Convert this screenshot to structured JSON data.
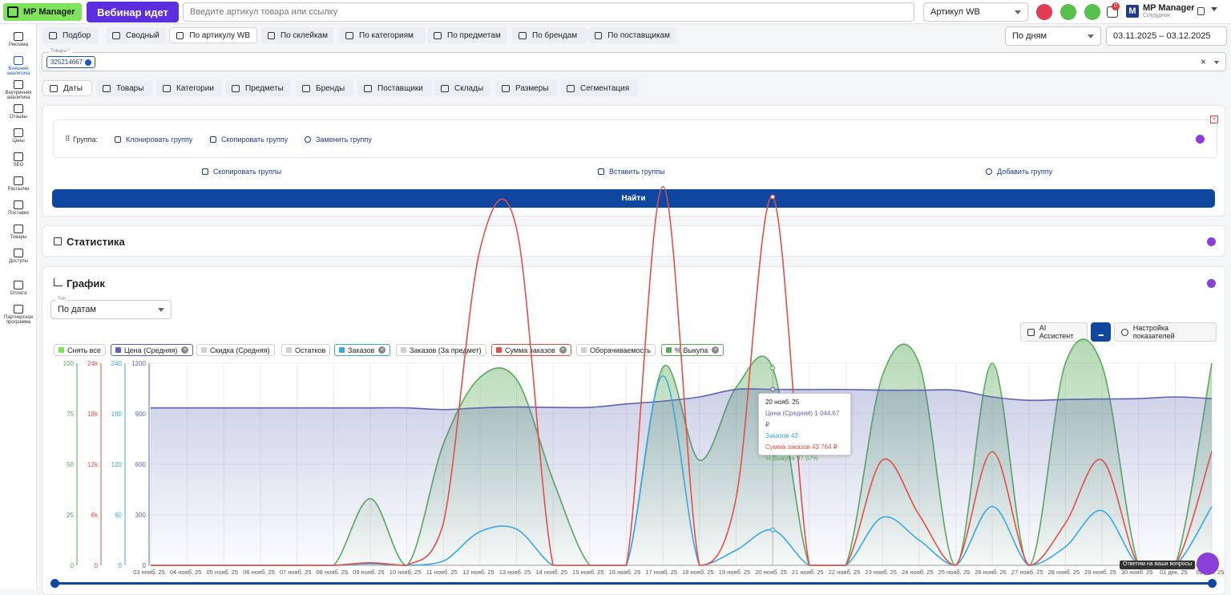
{
  "topbar": {
    "logo": "MP Manager",
    "webinar": "Вебинар идет",
    "search_placeholder": "Введите артикул товара или ссылку",
    "article_select": "Артикул WB",
    "notif_count": "0",
    "user_name": "MP Manager",
    "user_role": "Сотрудник"
  },
  "sidebar": [
    {
      "label": "Реклама",
      "icon": "ads-icon"
    },
    {
      "label": "Внешняя аналитика",
      "icon": "external-analytics-icon",
      "active": true
    },
    {
      "label": "Внутренняя аналитика",
      "icon": "internal-analytics-icon"
    },
    {
      "label": "Отзывы",
      "icon": "reviews-icon"
    },
    {
      "label": "Цены",
      "icon": "ruble-icon"
    },
    {
      "label": "SEO",
      "icon": "seo-icon"
    },
    {
      "label": "Рассылки",
      "icon": "mail-icon"
    },
    {
      "label": "Поставки",
      "icon": "truck-icon"
    },
    {
      "label": "Товары",
      "icon": "box-icon"
    },
    {
      "label": "Доступы",
      "icon": "lock-icon"
    },
    {
      "label": "Оплата",
      "icon": "wallet-icon"
    },
    {
      "label": "Партнерская программа",
      "icon": "partners-icon"
    }
  ],
  "tabs": [
    "Подбор",
    "Сводный",
    "По артикулу WB",
    "По склейкам",
    "По категориям",
    "По предметам",
    "По брендам",
    "По поставщикам"
  ],
  "period": {
    "value": "По дням",
    "date_range": "03.11.2025 – 03.12.2025"
  },
  "products": {
    "label": "Товары *",
    "chip": "325214667"
  },
  "subtabs": [
    "Даты",
    "Товары",
    "Категории",
    "Предметы",
    "Бренды",
    "Поставщики",
    "Склады",
    "Размеры",
    "Сегментация"
  ],
  "group": {
    "label": "Группа:",
    "clone": "Клонировать группу",
    "copy": "Скопировать группу",
    "replace": "Заменить группу",
    "copy_groups": "Скопировать группы",
    "paste_groups": "Вставить группы",
    "add_group": "Добавить группу",
    "find": "Найти"
  },
  "stats_title": "Статистика",
  "chart_section": {
    "title": "График",
    "type_label": "Тип",
    "type_value": "По датам",
    "ai": "AI Ассистент",
    "settings": "Настройка показателей",
    "chat_hint": "Ответим на ваши вопросы"
  },
  "legend": [
    {
      "label": "Снять все",
      "color": "#7ee35a",
      "x": false
    },
    {
      "label": "Цена (Средняя)",
      "color": "#5b64b0",
      "x": true
    },
    {
      "label": "Скидка (Средняя)",
      "color": "#cfcfcf",
      "x": false
    },
    {
      "label": "Остатков",
      "color": "#cfcfcf",
      "x": false
    },
    {
      "label": "Заказов",
      "color": "#3aa7e0",
      "x": true
    },
    {
      "label": "Заказов (За предмет)",
      "color": "#cfcfcf",
      "x": false
    },
    {
      "label": "Сумма заказов",
      "color": "#e0504a",
      "x": true
    },
    {
      "label": "Оборачиваемость",
      "color": "#cfcfcf",
      "x": false
    },
    {
      "label": "% Выкупа",
      "color": "#5aaa5a",
      "x": true
    }
  ],
  "tooltip": {
    "date": "20 нояб. 25",
    "price": "Цена (Средняя)  1 044.67 ₽",
    "orders": "Заказов  42",
    "sum": "Сумма заказов  43 764 ₽",
    "buyout": "% Выкупа  97.67%"
  },
  "chart_data": {
    "type": "area",
    "x": [
      "03 нояб. 25",
      "04 нояб. 25",
      "05 нояб. 25",
      "06 нояб. 25",
      "07 нояб. 25",
      "08 нояб. 25",
      "09 нояб. 25",
      "10 нояб. 25",
      "11 нояб. 25",
      "12 нояб. 25",
      "13 нояб. 25",
      "14 нояб. 25",
      "15 нояб. 25",
      "16 нояб. 25",
      "17 нояб. 25",
      "18 нояб. 25",
      "19 нояб. 25",
      "20 нояб. 25",
      "21 нояб. 25",
      "22 нояб. 25",
      "23 нояб. 25",
      "24 нояб. 25",
      "25 нояб. 25",
      "26 нояб. 25",
      "27 нояб. 25",
      "28 нояб. 25",
      "29 нояб. 25",
      "30 нояб. 25",
      "01 дек. 25",
      "02 дек. 25"
    ],
    "axes": [
      {
        "ticks": [
          "0",
          "25",
          "50",
          "75",
          "100"
        ],
        "color": "#5aaa5a",
        "max": 100
      },
      {
        "ticks": [
          "0",
          "6k",
          "12k",
          "18k",
          "24k"
        ],
        "color": "#e0504a",
        "max": 24000
      },
      {
        "ticks": [
          "0",
          "60",
          "120",
          "180",
          "240"
        ],
        "color": "#3aa7e0",
        "max": 240
      },
      {
        "ticks": [
          "0",
          "300",
          "600",
          "900",
          "1200"
        ],
        "color": "#5b64b0",
        "max": 1200
      }
    ],
    "series": [
      {
        "name": "% Выкупа",
        "color": "#5aaa5a",
        "axis": 0,
        "values": [
          0,
          0,
          0,
          0,
          0,
          0,
          33,
          0,
          60,
          93,
          92,
          42,
          0,
          0,
          98,
          52,
          88,
          97.67,
          0,
          0,
          94,
          100,
          0,
          100,
          0,
          100,
          99,
          0,
          0,
          100
        ]
      },
      {
        "name": "Цена (Средняя)",
        "color": "#5b64b0",
        "axis": 3,
        "values": [
          935,
          935,
          935,
          935,
          935,
          935,
          935,
          935,
          925,
          935,
          940,
          938,
          938,
          958,
          975,
          1000,
          1045,
          1044.67,
          1044,
          1044,
          1040,
          1040,
          1040,
          1000,
          980,
          985,
          988,
          990,
          1000,
          990
        ]
      },
      {
        "name": "Заказов",
        "color": "#3aa7e0",
        "axis": 2,
        "values": [
          0,
          0,
          0,
          0,
          0,
          0,
          2,
          0,
          5,
          40,
          43,
          0,
          0,
          0,
          225,
          0,
          18,
          42,
          0,
          0,
          57,
          30,
          0,
          70,
          0,
          22,
          65,
          0,
          0,
          70
        ]
      },
      {
        "name": "Сумма заказов",
        "color": "#e0504a",
        "axis": 1,
        "values": [
          0,
          0,
          0,
          0,
          0,
          0,
          300,
          0,
          5000,
          37500,
          40000,
          0,
          0,
          0,
          45000,
          0,
          8000,
          43764,
          0,
          0,
          12500,
          6000,
          0,
          13500,
          0,
          5000,
          12500,
          0,
          0,
          13500
        ]
      }
    ]
  }
}
